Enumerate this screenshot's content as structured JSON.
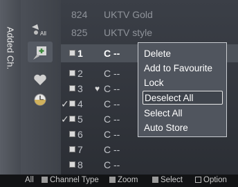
{
  "side_tab": {
    "label": "Added Ch."
  },
  "icons": [
    {
      "name": "all-channels-icon",
      "label": "All"
    },
    {
      "name": "added-channels-icon"
    },
    {
      "name": "favourite-icon"
    },
    {
      "name": "programmed-icon"
    }
  ],
  "channels": [
    {
      "num": "824",
      "name": "UKTV Gold"
    },
    {
      "num": "825",
      "name": "UKTV style"
    },
    {
      "num": "1",
      "name": "C --",
      "selected": true
    },
    {
      "num": "2",
      "name": "C --"
    },
    {
      "num": "3",
      "name": "C --",
      "favourite": true
    },
    {
      "num": "4",
      "name": "C --",
      "checked": true
    },
    {
      "num": "5",
      "name": "C --",
      "checked": true
    },
    {
      "num": "6",
      "name": "C --"
    },
    {
      "num": "7",
      "name": "C --"
    },
    {
      "num": "8",
      "name": "C --"
    }
  ],
  "menu": {
    "items": [
      "Delete",
      "Add to Favourite",
      "Lock",
      "Deselect All",
      "Select All",
      "Auto Store"
    ],
    "highlighted": 3
  },
  "bottom_bar": {
    "all": "All",
    "channel_type": "Channel Type",
    "zoom": "Zoom",
    "select": "Select",
    "option": "Option"
  },
  "colors": {
    "accent": "#50555e",
    "background": "#3b3f47"
  }
}
